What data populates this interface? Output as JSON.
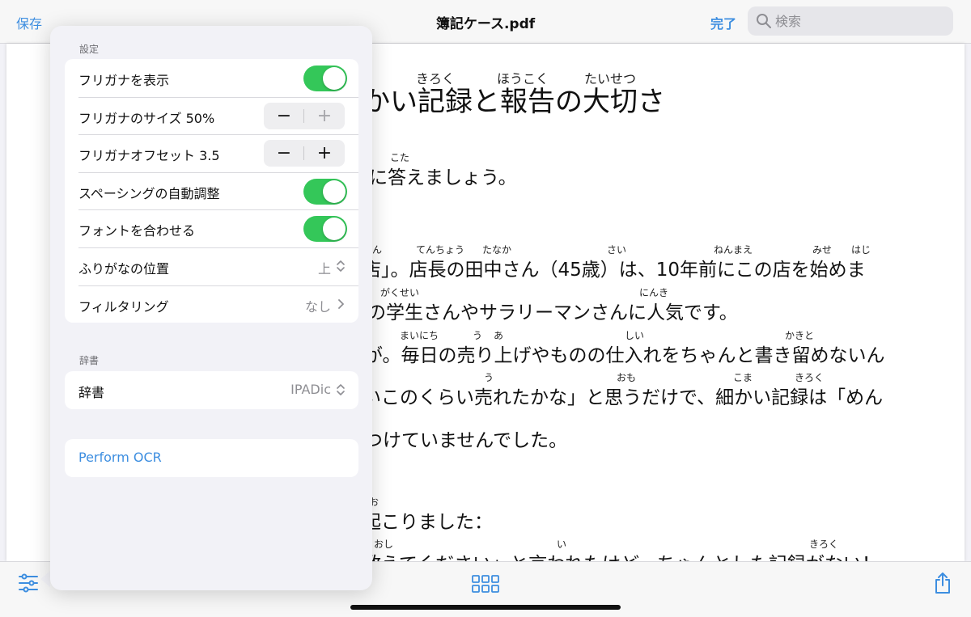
{
  "topbar": {
    "save_label": "保存",
    "title": "簿記ケース.pdf",
    "done_label": "完了",
    "search_placeholder": "検索"
  },
  "document": {
    "lines": [
      "かい記録と報告の大切さ",
      "に答えましょう。",
      "店」。店長の田中さん（45歳）は、10年前にこの店を始めま",
      "の学生さんやサラリーマンさんに人気です。",
      "が。毎日の売り上げやものの仕入れをちゃんと書き留めないん",
      "いこのくらい売れたかな」と思うだけで、細かい記録は「めん",
      "つけていませんでした。",
      "起こりました：",
      "教えてください」と言われたけど、ちゃんとした記録がない！"
    ],
    "ruby": [
      "きろく",
      "ほうこく",
      "たいせつ",
      "こた",
      "ん",
      "てんちょう",
      "たなか",
      "さい",
      "ねんまえ",
      "みせ",
      "はじ",
      "がくせい",
      "にんき",
      "まいにち",
      "う",
      "あ",
      "しい",
      "かきと",
      "う",
      "おも",
      "こま",
      "きろく",
      "お",
      "おし",
      "い",
      "きろく"
    ]
  },
  "settings": {
    "section_title": "設定",
    "rows": [
      {
        "label": "フリガナを表示",
        "control": "toggle",
        "on": true
      },
      {
        "label": "フリガナのサイズ 50%",
        "control": "stepper",
        "minus": "−",
        "plus": "+"
      },
      {
        "label": "フリガナオフセット 3.5",
        "control": "stepper",
        "minus": "−",
        "plus": "+"
      },
      {
        "label": "スペーシングの自動調整",
        "control": "toggle",
        "on": true
      },
      {
        "label": "フォントを合わせる",
        "control": "toggle",
        "on": true
      },
      {
        "label": "ふりがなの位置",
        "control": "menu",
        "value": "上"
      },
      {
        "label": "フィルタリング",
        "control": "disclosure",
        "value": "なし"
      }
    ]
  },
  "dictionary": {
    "section_title": "辞書",
    "row_label": "辞書",
    "value": "IPADic"
  },
  "ocr": {
    "label": "Perform OCR"
  },
  "icons": {
    "search": "search-icon",
    "settings_sliders": "sliders-icon",
    "thumbnail_grid": "grid-icon",
    "share": "share-icon",
    "updown_chevron": "chevron-updown-icon",
    "chevron_right": "chevron-right-icon"
  },
  "colors": {
    "accent": "#3d8ee0",
    "toggle_on": "#34c759",
    "panel_bg": "#f2f2f7"
  }
}
